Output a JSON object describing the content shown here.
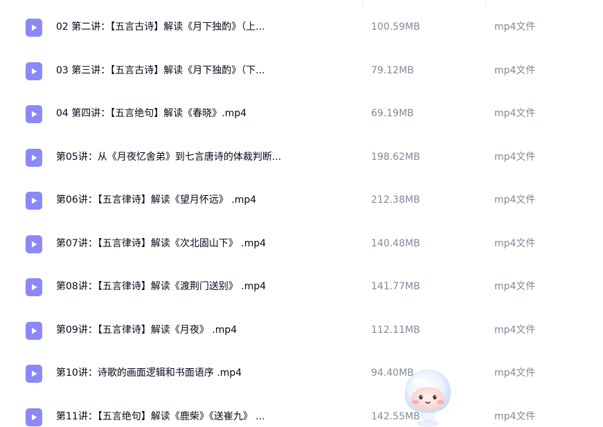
{
  "files": [
    {
      "name": "02 第二讲：【五言古诗】解读《月下独酌》（上...",
      "size": "100.59MB",
      "type": "mp4文件"
    },
    {
      "name": "03 第三讲：【五言古诗】解读《月下独酌》（下...",
      "size": "79.12MB",
      "type": "mp4文件"
    },
    {
      "name": "04 第四讲：【五言绝句】解读《春晓》.mp4",
      "size": "69.19MB",
      "type": "mp4文件"
    },
    {
      "name": "第05讲：从《月夜忆舍弟》到七言唐诗的体裁判断...",
      "size": "198.62MB",
      "type": "mp4文件"
    },
    {
      "name": "第06讲：【五言律诗】解读《望月怀远》 .mp4",
      "size": "212.38MB",
      "type": "mp4文件"
    },
    {
      "name": "第07讲：【五言律诗】解读《次北固山下》 .mp4",
      "size": "140.48MB",
      "type": "mp4文件"
    },
    {
      "name": "第08讲：【五言律诗】解读《渡荆门送别》 .mp4",
      "size": "141.77MB",
      "type": "mp4文件"
    },
    {
      "name": "第09讲：【五言律诗】解读《月夜》 .mp4",
      "size": "112.11MB",
      "type": "mp4文件"
    },
    {
      "name": "第10讲：诗歌的画面逻辑和书面语序 .mp4",
      "size": "94.40MB",
      "type": "mp4文件"
    },
    {
      "name": "第11讲：【五言绝句】解读《鹿柴》《送崔九》 ...",
      "size": "142.55MB",
      "type": "mp4文件"
    }
  ],
  "colors": {
    "file_icon": "#8b88f7",
    "name_text": "#03081a",
    "meta_text": "#818999"
  },
  "icons": {
    "file": "video-file-icon",
    "assistant": "assistant-mascot-icon"
  }
}
